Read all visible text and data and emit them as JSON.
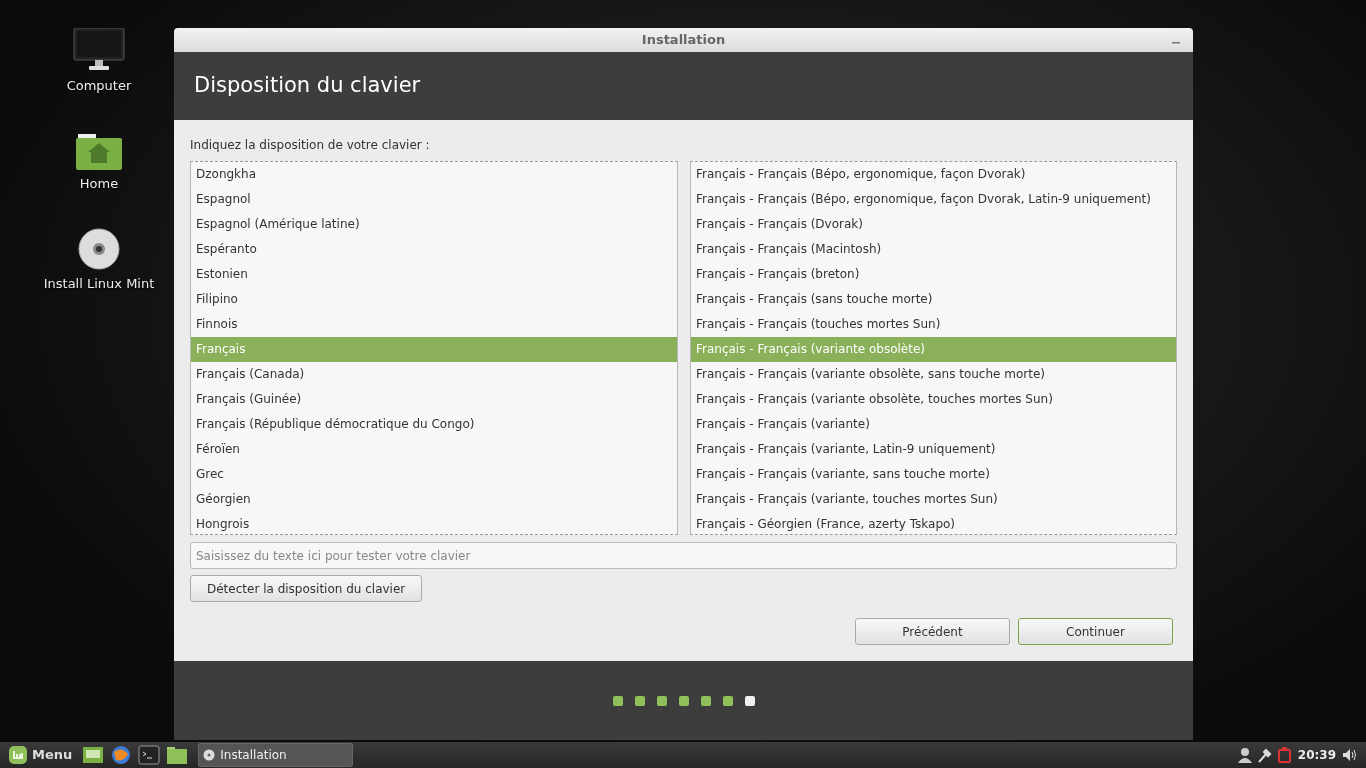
{
  "desktop_icons": [
    {
      "kind": "computer",
      "label": "Computer"
    },
    {
      "kind": "home",
      "label": "Home"
    },
    {
      "kind": "disc",
      "label": "Install Linux Mint"
    }
  ],
  "window": {
    "title": "Installation",
    "heading": "Disposition du clavier",
    "prompt": "Indiquez la disposition de votre clavier :",
    "layouts": [
      {
        "label": "Dzongkha",
        "selected": false
      },
      {
        "label": "Espagnol",
        "selected": false
      },
      {
        "label": "Espagnol (Amérique latine)",
        "selected": false
      },
      {
        "label": "Espéranto",
        "selected": false
      },
      {
        "label": "Estonien",
        "selected": false
      },
      {
        "label": "Filipino",
        "selected": false
      },
      {
        "label": "Finnois",
        "selected": false
      },
      {
        "label": "Français",
        "selected": true
      },
      {
        "label": "Français (Canada)",
        "selected": false
      },
      {
        "label": "Français (Guinée)",
        "selected": false
      },
      {
        "label": "Français (République démocratique du Congo)",
        "selected": false
      },
      {
        "label": "Féroïen",
        "selected": false
      },
      {
        "label": "Grec",
        "selected": false
      },
      {
        "label": "Géorgien",
        "selected": false
      },
      {
        "label": "Hongrois",
        "selected": false
      }
    ],
    "variants": [
      {
        "label": "Français - Français (Bépo, ergonomique, façon Dvorak)",
        "selected": false
      },
      {
        "label": "Français - Français (Bépo, ergonomique, façon Dvorak, Latin-9 uniquement)",
        "selected": false
      },
      {
        "label": "Français - Français (Dvorak)",
        "selected": false
      },
      {
        "label": "Français - Français (Macintosh)",
        "selected": false
      },
      {
        "label": "Français - Français (breton)",
        "selected": false
      },
      {
        "label": "Français - Français (sans touche morte)",
        "selected": false
      },
      {
        "label": "Français - Français (touches mortes Sun)",
        "selected": false
      },
      {
        "label": "Français - Français (variante obsolète)",
        "selected": true
      },
      {
        "label": "Français - Français (variante obsolète, sans touche morte)",
        "selected": false
      },
      {
        "label": "Français - Français (variante obsolète, touches mortes Sun)",
        "selected": false
      },
      {
        "label": "Français - Français (variante)",
        "selected": false
      },
      {
        "label": "Français - Français (variante, Latin-9 uniquement)",
        "selected": false
      },
      {
        "label": "Français - Français (variante, sans touche morte)",
        "selected": false
      },
      {
        "label": "Français - Français (variante, touches mortes Sun)",
        "selected": false
      },
      {
        "label": "Français - Géorgien (France, azerty Tskapo)",
        "selected": false
      }
    ],
    "test_field": {
      "placeholder": "Saisissez du texte ici pour tester votre clavier"
    },
    "detect_button": "Détecter la disposition du clavier",
    "back_button": "Précédent",
    "continue_button": "Continuer",
    "steps": [
      {
        "done": true
      },
      {
        "done": true
      },
      {
        "done": true
      },
      {
        "done": true
      },
      {
        "done": true
      },
      {
        "done": true
      },
      {
        "done": false
      }
    ]
  },
  "taskbar": {
    "menu_label": "Menu",
    "launchers": [
      {
        "kind": "desktop"
      },
      {
        "kind": "browser"
      },
      {
        "kind": "terminal"
      },
      {
        "kind": "folder"
      }
    ],
    "task": "Installation",
    "clock": "20:39"
  }
}
